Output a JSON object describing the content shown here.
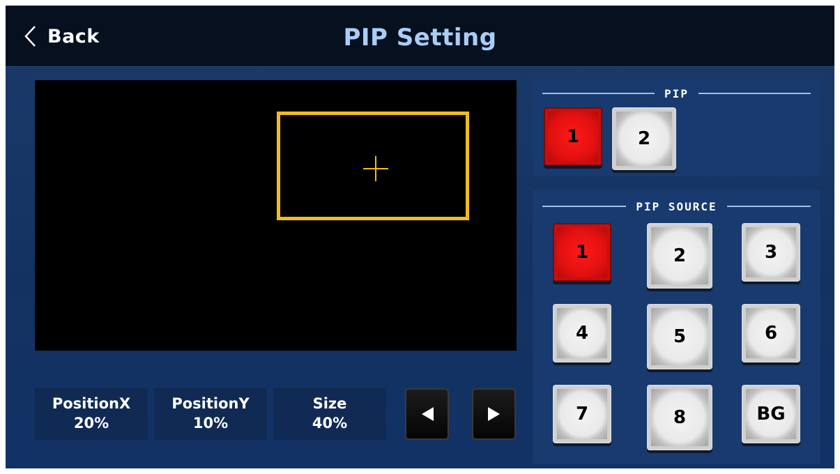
{
  "header": {
    "back_label": "Back",
    "title": "PIP Setting"
  },
  "preview": {
    "pip_box_color": "#f2bd1a"
  },
  "info": {
    "position_x_label": "PositionX",
    "position_x_value": "20%",
    "position_y_label": "PositionY",
    "position_y_value": "10%",
    "size_label": "Size",
    "size_value": "40%"
  },
  "pip_panel": {
    "title": "PIP",
    "buttons": [
      {
        "label": "1",
        "active": true
      },
      {
        "label": "2",
        "active": false
      }
    ]
  },
  "source_panel": {
    "title": "PIP SOURCE",
    "buttons": [
      {
        "label": "1",
        "active": true
      },
      {
        "label": "2",
        "active": false
      },
      {
        "label": "3",
        "active": false
      },
      {
        "label": "4",
        "active": false
      },
      {
        "label": "5",
        "active": false
      },
      {
        "label": "6",
        "active": false
      },
      {
        "label": "7",
        "active": false
      },
      {
        "label": "8",
        "active": false
      },
      {
        "label": "BG",
        "active": false
      }
    ]
  },
  "colors": {
    "active_key": "#e01010",
    "title_text": "#a9cdf5",
    "background": "#143261"
  }
}
